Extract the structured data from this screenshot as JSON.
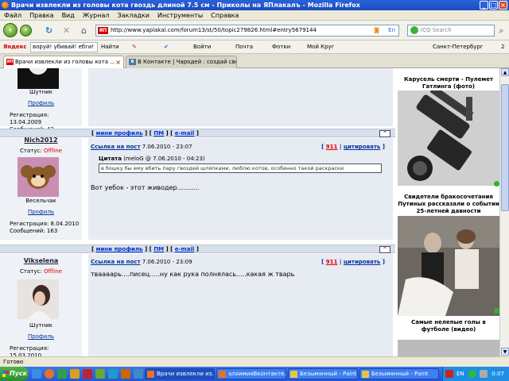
{
  "window": {
    "title": "Врачи извлекли из головы кота гвоздь длиной 7.5 см - Приколы на ЯПлакалъ - Mozilla Firefox",
    "controls": [
      "_",
      "□",
      "×"
    ]
  },
  "menu": [
    "Файл",
    "Правка",
    "Вид",
    "Журнал",
    "Закладки",
    "Инструменты",
    "Справка"
  ],
  "nav": {
    "url": "http://www.yaplakal.com/forum13/st/50/topic279826.html#entry5679144",
    "url_badge": "ЯП",
    "search_placeholder": "ICQ Search",
    "lang_label": "En"
  },
  "yabar": {
    "logo": "Яндекс",
    "query": "воруй! убивай! ебги!",
    "find": "Найти",
    "items": [
      "Войти",
      "Почта",
      "Фотки",
      "Мой Круг"
    ],
    "city": "Санкт-Петербург",
    "count": "2"
  },
  "tabs": [
    {
      "label": "Врачи извлекли из головы кота ...",
      "icon": "ЯП",
      "active": true
    },
    {
      "label": "В Контакте | Чародей : создай свою ...",
      "icon": "B",
      "active": false
    }
  ],
  "posts": [
    {
      "rank": "Шутник",
      "profile": "Профиль",
      "reg": "Регистрация: 13.04.2009",
      "msgs": "Сообщений: 43"
    },
    {
      "username": "Nich2012",
      "status_label": "Статус:",
      "status": "Offline",
      "rank": "Весельчак",
      "profile": "Профиль",
      "reg": "Регистрация: 8.04.2010",
      "msgs": "Сообщений: 163",
      "link": "Ссылка на пост",
      "date": "7.06.2010 - 23:07",
      "num": "911",
      "quote_btn": "цитировать",
      "quote_title": "Цитата",
      "quote_meta": "(meloG @ 7.06.2010 - 04:23)",
      "quote_text": "в бошку бы ему вбить пару гвоздей шляпками, люблю котов, особенно такой раскраски",
      "text": "Вот уебок - этот живодер..........."
    },
    {
      "username": "Vikselena",
      "status_label": "Статус:",
      "status": "Offline",
      "rank": "Шутник",
      "profile": "Профиль",
      "reg": "Регистрация: 15.03.2010",
      "link": "Ссылка на пост",
      "date": "7.06.2010 - 23:09",
      "num": "911",
      "quote_btn": "цитировать",
      "text": "тваааарь....писец.....ну как рука полнялась.....какая ж тварь"
    }
  ],
  "sep_links": {
    "mini": "мини профиль",
    "pm": "ПМ",
    "email": "e-mail"
  },
  "sidebar": [
    {
      "title": "Карусель смерти - Пулемет Гатлинга (фото)"
    },
    {
      "title": "Свидетели бракосочетания Путиных рассказали о событии 25-летней давности"
    },
    {
      "title": "Самые нелепые голы в футболе (видео)"
    }
  ],
  "status": "Готово",
  "taskbar": {
    "start": "Пуск",
    "tasks": [
      {
        "label": "Врачи извлекли из...",
        "active": true
      },
      {
        "label": "алхимияВконтакте.r...",
        "active": false
      },
      {
        "label": "Безымянный - Paint",
        "active": false
      },
      {
        "label": "Безымянный - Paint",
        "active": false
      }
    ],
    "lang": "EN",
    "clock": "0:07"
  },
  "colors": {
    "link": "#003399",
    "offline": "#dd0000",
    "post_bg": "#e7ebf2",
    "sep_bg": "#d7dfeb"
  }
}
